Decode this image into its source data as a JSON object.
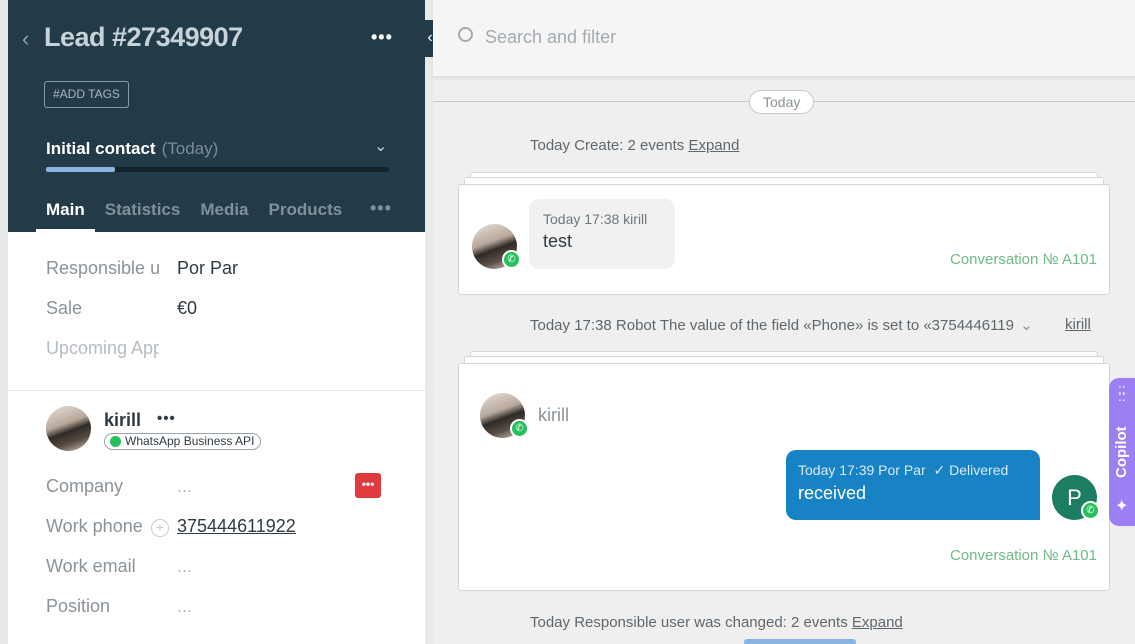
{
  "lead": {
    "title": "Lead #27349907",
    "add_tags": "#ADD TAGS",
    "stage": "Initial contact",
    "stage_when": "(Today)",
    "stage_progress": 0.2,
    "tabs": [
      "Main",
      "Statistics",
      "Media",
      "Products"
    ],
    "more": "•••"
  },
  "fields": [
    {
      "label": "Responsible u",
      "value": "Por Par"
    },
    {
      "label": "Sale",
      "value": "€0"
    },
    {
      "label": "Upcoming App",
      "value": ""
    }
  ],
  "contact": {
    "name": "kirill",
    "more": "•••",
    "channel": "WhatsApp Business API",
    "rows": [
      {
        "label": "Company",
        "value": "..."
      },
      {
        "label": "Work phone",
        "value": "375444611922"
      },
      {
        "label": "Work email",
        "value": "..."
      },
      {
        "label": "Position",
        "value": "..."
      }
    ],
    "action_icon": "•••"
  },
  "search": {
    "placeholder": "Search and filter"
  },
  "feed": {
    "day_label": "Today",
    "event1": {
      "text": "Today Create: 2 events",
      "link": "Expand"
    },
    "msg1": {
      "meta": "Today 17:38 kirill",
      "text": "test",
      "conversation": "Conversation № A101"
    },
    "event2": {
      "text": "Today 17:38 Robot The value of the field «Phone» is set to «3754446119",
      "author": "kirill"
    },
    "msg2": {
      "sender": "kirill",
      "out_meta": "Today 17:39 Por Par",
      "status": "Delivered",
      "out_text": "received",
      "avatar_letter": "P",
      "conversation": "Conversation № A101"
    },
    "event3": {
      "text": "Today Responsible user was changed: 2 events",
      "link": "Expand"
    }
  },
  "copilot": {
    "label": "Copilot"
  },
  "colors": {
    "header": "#233b49",
    "accent": "#1782c4",
    "whatsapp": "#25c05a",
    "copilot": "#9c7ff2"
  }
}
